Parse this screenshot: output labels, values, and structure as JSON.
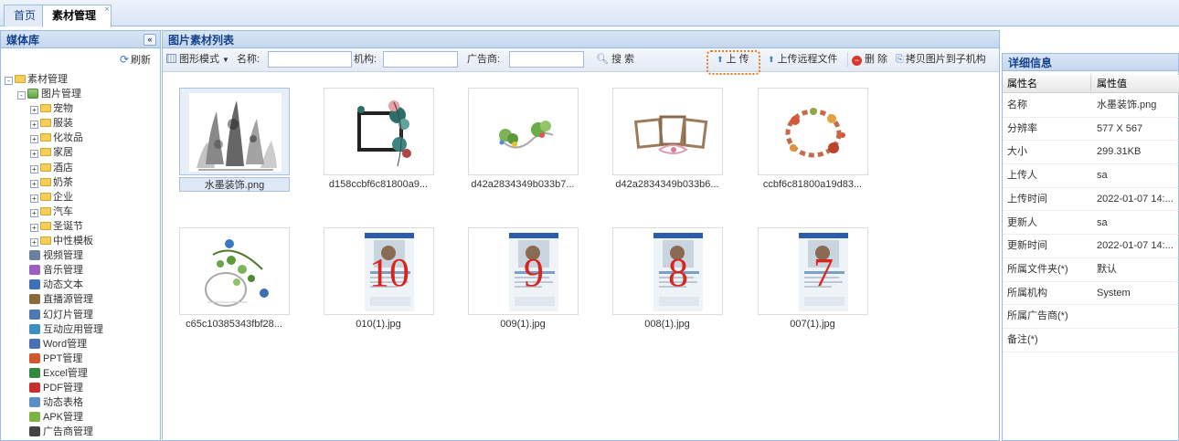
{
  "tabs": [
    {
      "label": "首页"
    },
    {
      "label": "素材管理",
      "close": "×"
    }
  ],
  "sidebar": {
    "title": "媒体库",
    "collapse": "«",
    "refresh": "刷新",
    "tree": [
      {
        "label": "素材管理",
        "level": 0,
        "toggle": "-",
        "icon": "folder"
      },
      {
        "label": "图片管理",
        "level": 1,
        "toggle": "-",
        "icon": "image"
      },
      {
        "label": "宠物",
        "level": 2,
        "toggle": "+",
        "icon": "folder"
      },
      {
        "label": "服装",
        "level": 2,
        "toggle": "+",
        "icon": "folder"
      },
      {
        "label": "化妆品",
        "level": 2,
        "toggle": "+",
        "icon": "folder"
      },
      {
        "label": "家居",
        "level": 2,
        "toggle": "+",
        "icon": "folder"
      },
      {
        "label": "酒店",
        "level": 2,
        "toggle": "+",
        "icon": "folder"
      },
      {
        "label": "奶茶",
        "level": 2,
        "toggle": "+",
        "icon": "folder"
      },
      {
        "label": "企业",
        "level": 2,
        "toggle": "+",
        "icon": "folder"
      },
      {
        "label": "汽车",
        "level": 2,
        "toggle": "+",
        "icon": "folder"
      },
      {
        "label": "圣诞节",
        "level": 2,
        "toggle": "+",
        "icon": "folder"
      },
      {
        "label": "中性模板",
        "level": 2,
        "toggle": "+",
        "icon": "folder"
      },
      {
        "label": "视频管理",
        "level": 1,
        "icon": "video",
        "color": "#6b7f9e"
      },
      {
        "label": "音乐管理",
        "level": 1,
        "icon": "music",
        "color": "#9b5fbf"
      },
      {
        "label": "动态文本",
        "level": 1,
        "icon": "text",
        "color": "#3f6fb6"
      },
      {
        "label": "直播源管理",
        "level": 1,
        "icon": "live",
        "color": "#8a6a3a"
      },
      {
        "label": "幻灯片管理",
        "level": 1,
        "icon": "slides",
        "color": "#4d78b0"
      },
      {
        "label": "互动应用管理",
        "level": 1,
        "icon": "app",
        "color": "#3d8fbf"
      },
      {
        "label": "Word管理",
        "level": 1,
        "icon": "word",
        "color": "#4a6fb5"
      },
      {
        "label": "PPT管理",
        "level": 1,
        "icon": "ppt",
        "color": "#d2572a"
      },
      {
        "label": "Excel管理",
        "level": 1,
        "icon": "excel",
        "color": "#2f8a3f"
      },
      {
        "label": "PDF管理",
        "level": 1,
        "icon": "pdf",
        "color": "#c9302c"
      },
      {
        "label": "动态表格",
        "level": 1,
        "icon": "table",
        "color": "#5b8fc7"
      },
      {
        "label": "APK管理",
        "level": 1,
        "icon": "android",
        "color": "#7cb342"
      },
      {
        "label": "广告商管理",
        "level": 1,
        "icon": "user",
        "color": "#444444"
      }
    ]
  },
  "main": {
    "title": "图片素材列表",
    "toolbar": {
      "view_mode": "图形模式",
      "name_label": "名称:",
      "org_label": "机构:",
      "advertiser_label": "广告商:",
      "search": "搜 索",
      "upload": "上 传",
      "upload_remote": "上传远程文件",
      "delete": "删 除",
      "copy_to_child": "拷贝图片到子机构"
    },
    "images": [
      {
        "name": "水墨装饰.png",
        "selected": true,
        "kind": "ink"
      },
      {
        "name": "d158ccbf6c81800a9...",
        "kind": "frame-flowers"
      },
      {
        "name": "d42a2834349b033b7...",
        "kind": "green-vine"
      },
      {
        "name": "d42a2834349b033b6...",
        "kind": "photo-frames"
      },
      {
        "name": "ccbf6c81800a19d83...",
        "kind": "floral-wreath"
      },
      {
        "name": "c65c10385343fbf28...",
        "kind": "birdcage"
      },
      {
        "name": "010(1).jpg",
        "kind": "poster",
        "number": "10"
      },
      {
        "name": "009(1).jpg",
        "kind": "poster",
        "number": "9"
      },
      {
        "name": "008(1).jpg",
        "kind": "poster",
        "number": "8"
      },
      {
        "name": "007(1).jpg",
        "kind": "poster",
        "number": "7"
      }
    ]
  },
  "detail": {
    "title": "详细信息",
    "col_name": "属性名",
    "col_value": "属性值",
    "rows": [
      {
        "k": "名称",
        "v": "水墨装饰.png"
      },
      {
        "k": "分辨率",
        "v": "577 X 567"
      },
      {
        "k": "大小",
        "v": "299.31KB"
      },
      {
        "k": "上传人",
        "v": "sa"
      },
      {
        "k": "上传时间",
        "v": "2022-01-07 14:..."
      },
      {
        "k": "更新人",
        "v": "sa"
      },
      {
        "k": "更新时间",
        "v": "2022-01-07 14:..."
      },
      {
        "k": "所属文件夹(*)",
        "v": "默认"
      },
      {
        "k": "所属机构",
        "v": "System"
      },
      {
        "k": "所属广告商(*)",
        "v": ""
      },
      {
        "k": "备注(*)",
        "v": ""
      }
    ]
  },
  "colors": {
    "accent": "#15428b",
    "border": "#99bbe8",
    "highlight": "#e8791e",
    "number_red": "#d9251d"
  }
}
